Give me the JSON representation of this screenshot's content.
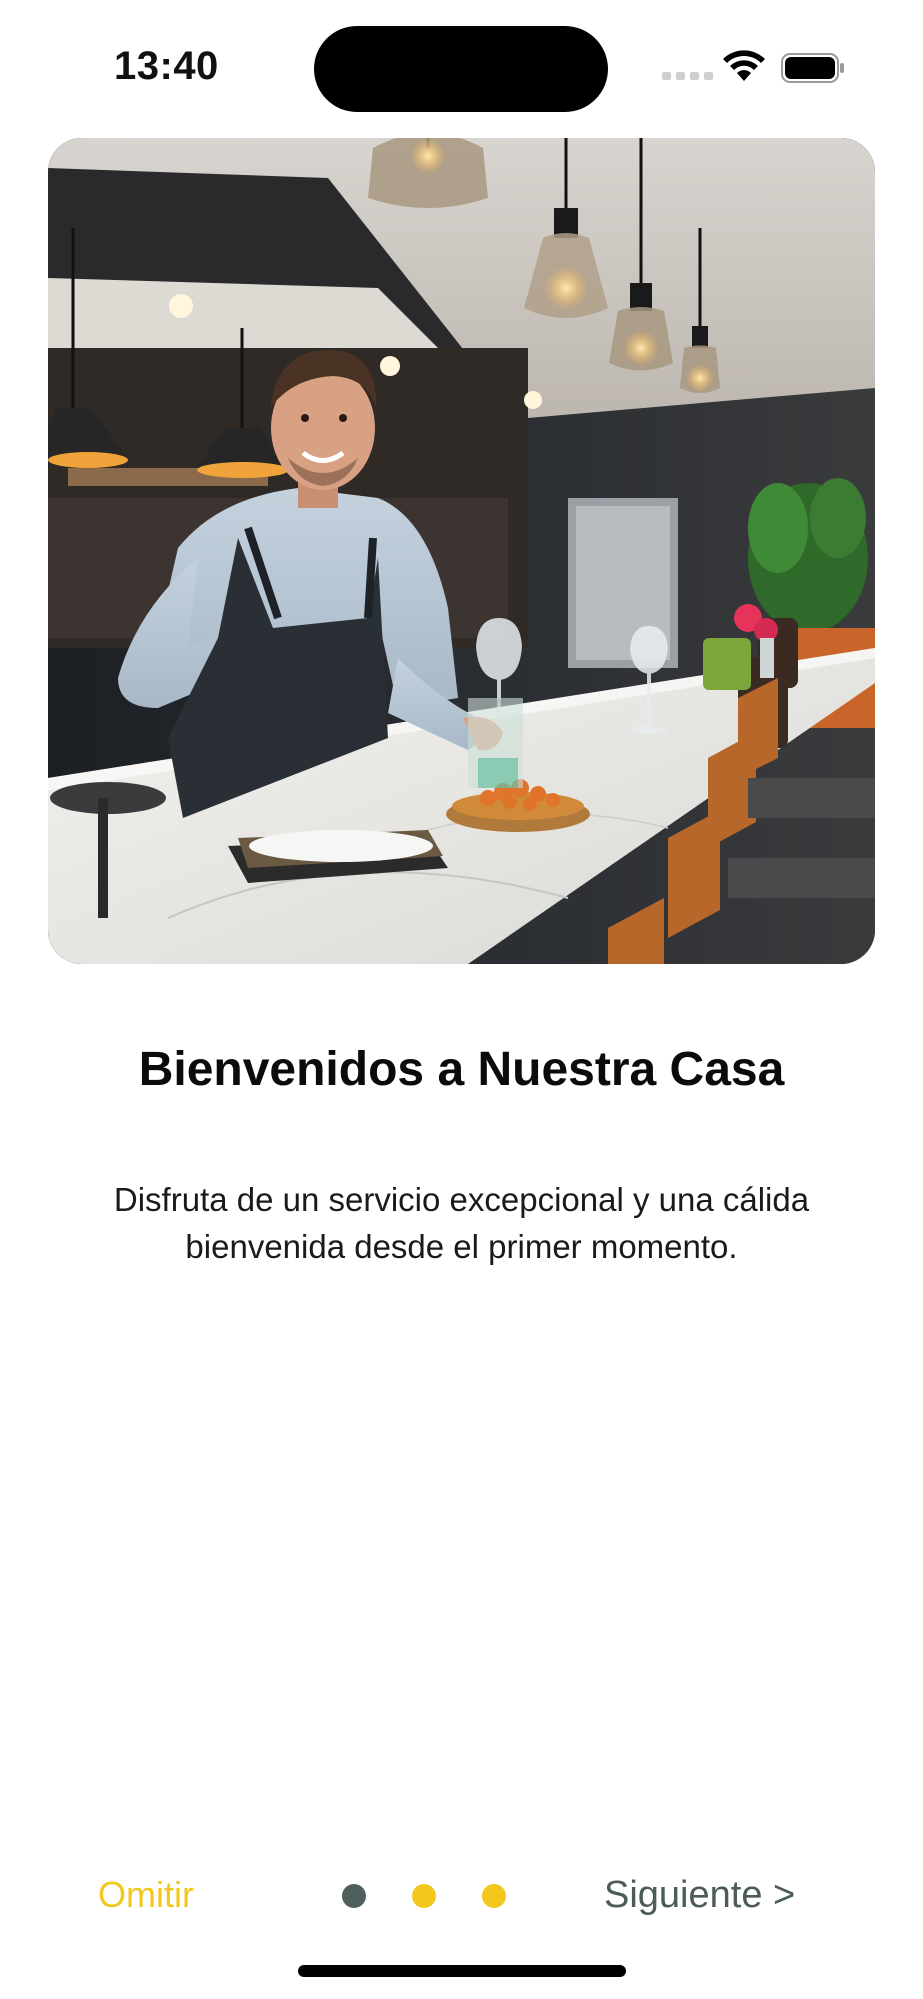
{
  "status_bar": {
    "time": "13:40"
  },
  "onboarding": {
    "image_alt": "Camarero sonriente sirviendo un plato en la barra de un restaurante",
    "title": "Bienvenidos a Nuestra Casa",
    "description": "Disfruta de un servicio excepcional y una cálida bienvenida desde el primer momento."
  },
  "navigation": {
    "skip_label": "Omitir",
    "next_label": "Siguiente >",
    "page_indicator": {
      "total_pages": 3,
      "current_page": 1
    }
  },
  "colors": {
    "accent": "#f2c81e",
    "active_dot": "#4f5f5d",
    "next_text": "#4a5b5a"
  }
}
